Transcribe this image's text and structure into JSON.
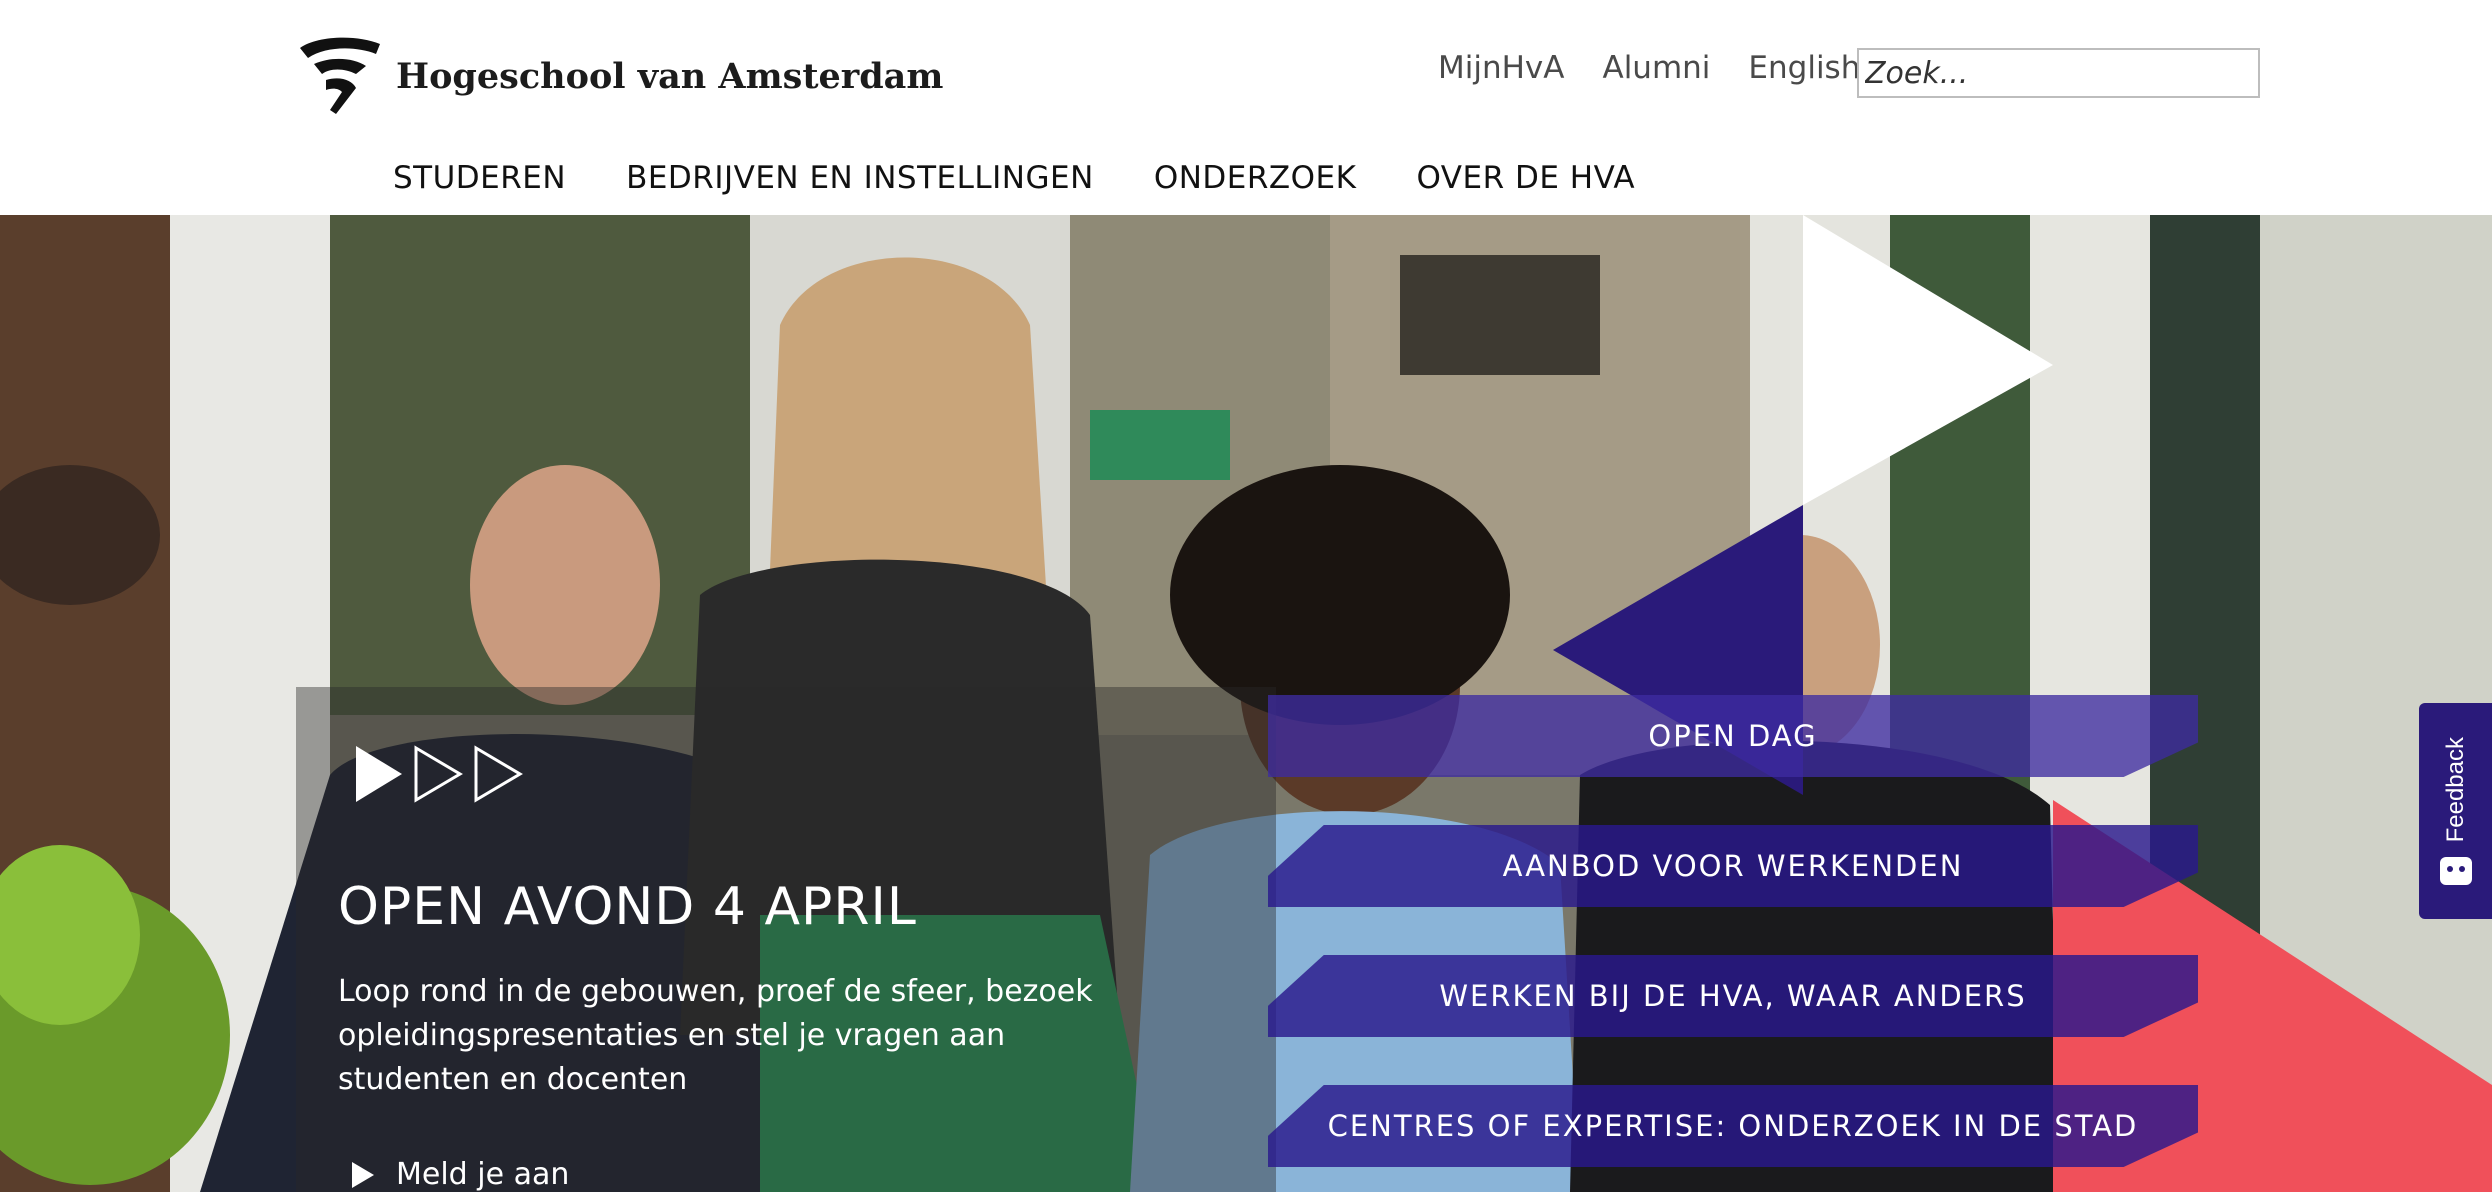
{
  "site": {
    "name": "Hogeschool van Amsterdam"
  },
  "header": {
    "util_links": [
      {
        "label": "MijnHvA"
      },
      {
        "label": "Alumni"
      },
      {
        "label": "English"
      }
    ],
    "search": {
      "placeholder": "Zoek..."
    },
    "nav": [
      {
        "label": "STUDEREN"
      },
      {
        "label": "BEDRIJVEN EN INSTELLINGEN"
      },
      {
        "label": "ONDERZOEK"
      },
      {
        "label": "OVER DE HVA"
      }
    ]
  },
  "hero": {
    "title": "OPEN AVOND 4 APRIL",
    "description": "Loop rond in de gebouwen, proef de sfeer, bezoek opleidingspresentaties en stel je vragen aan studenten en docenten",
    "cta": "Meld je aan",
    "links": [
      {
        "label": "OPEN DAG"
      },
      {
        "label": "AANBOD VOOR WERKENDEN"
      },
      {
        "label": "WERKEN BIJ DE HVA, WAAR ANDERS"
      },
      {
        "label": "CENTRES OF EXPERTISE: ONDERZOEK IN DE STAD"
      }
    ]
  },
  "feedback": {
    "label": "Feedback",
    "icon": "chat-icon"
  },
  "colors": {
    "brand_purple": "#2a1a7a",
    "link_purple": "#3e2ca0",
    "accent_red": "#f0505a",
    "white": "#ffffff"
  }
}
